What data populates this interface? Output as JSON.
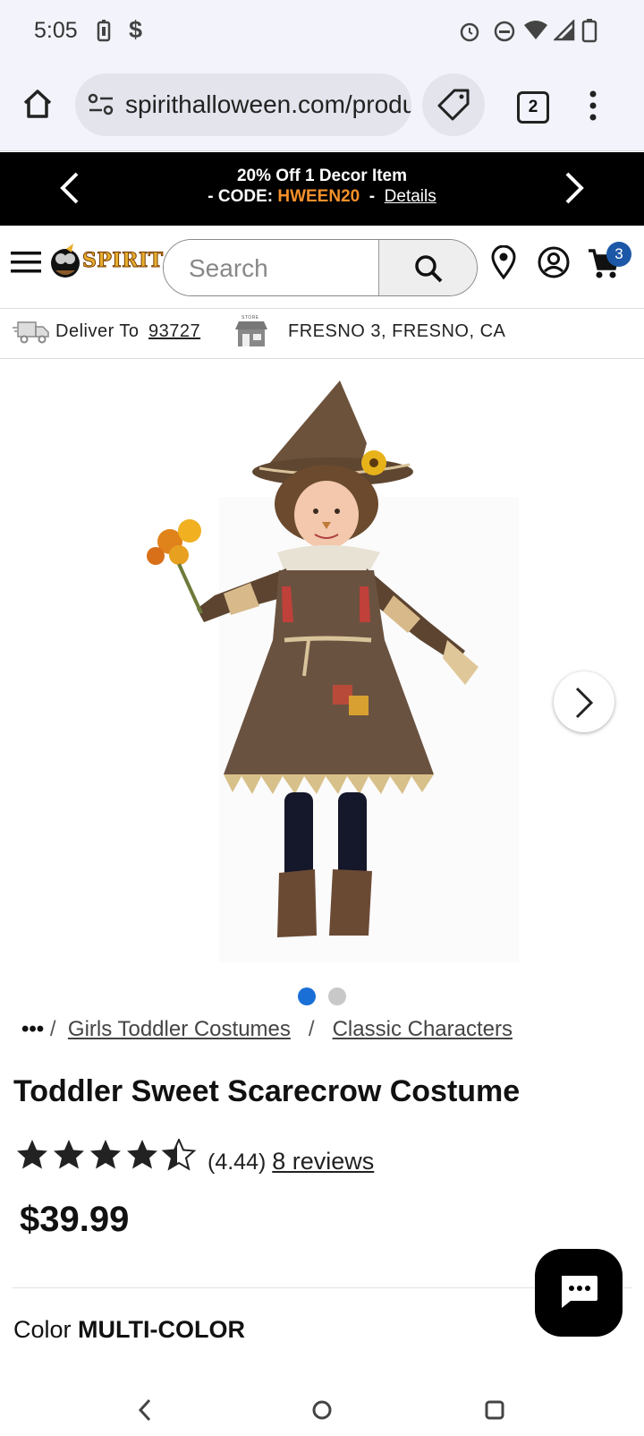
{
  "status_bar": {
    "time": "5:05"
  },
  "browser": {
    "url": "spirithalloween.com/products/toddler-sweet-scarecrow-costume",
    "tab_count": "2"
  },
  "promo": {
    "line1": "20% Off 1 Decor Item",
    "code_prefix": "- CODE:",
    "code": "HWEEN20",
    "separator": "-",
    "details": "Details"
  },
  "header": {
    "logo": "SPIRIT",
    "search_placeholder": "Search",
    "cart_count": "3"
  },
  "delivery": {
    "deliver_label": "Deliver To",
    "zip": "93727",
    "store_label": "STORE",
    "store": "FRESNO 3, FRESNO, CA"
  },
  "breadcrumb": {
    "more": "•••",
    "sep": "/",
    "items": [
      "Girls Toddler Costumes",
      "Classic Characters"
    ]
  },
  "product": {
    "title": "Toddler Sweet Scarecrow Costume",
    "rating": 4.44,
    "rating_text": "(4.44)",
    "reviews": "8 reviews",
    "price": "$39.99",
    "color_label": "Color",
    "color_value": "MULTI-COLOR"
  },
  "carousel": {
    "slide_count": 2,
    "active_index": 0
  },
  "colors": {
    "promo_code": "#f5902a",
    "cart_badge": "#1d57a7",
    "active_dot": "#1a6fd6"
  }
}
